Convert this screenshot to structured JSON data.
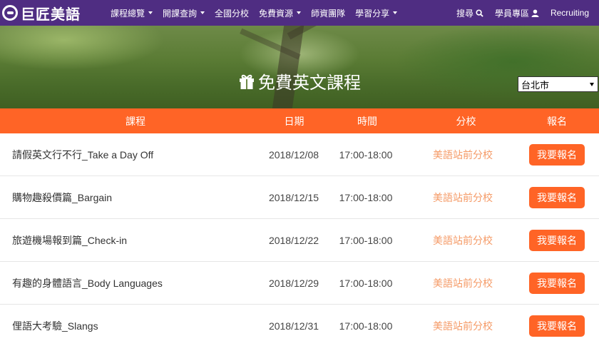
{
  "brand": {
    "logo_text": "巨匠美語"
  },
  "nav": {
    "items": [
      {
        "label": "課程總覽",
        "dropdown": true
      },
      {
        "label": "開課查詢",
        "dropdown": true
      },
      {
        "label": "全國分校",
        "dropdown": false
      },
      {
        "label": "免費資源",
        "dropdown": true
      },
      {
        "label": "師資團隊",
        "dropdown": false
      },
      {
        "label": "學習分享",
        "dropdown": true
      }
    ],
    "search_label": "搜尋",
    "member_label": "學員專區",
    "recruiting_label": "Recruiting"
  },
  "hero": {
    "title": "免費英文課程",
    "icon": "gift-icon"
  },
  "city_select": {
    "selected": "台北市"
  },
  "table": {
    "headers": [
      "課程",
      "日期",
      "時間",
      "分校",
      "報名"
    ],
    "rows": [
      {
        "course": "請假英文行不行_Take a Day Off",
        "date": "2018/12/08",
        "time": "17:00-18:00",
        "branch": "美語站前分校",
        "action": "我要報名"
      },
      {
        "course": "購物趣殺價篇_Bargain",
        "date": "2018/12/15",
        "time": "17:00-18:00",
        "branch": "美語站前分校",
        "action": "我要報名"
      },
      {
        "course": "旅遊機場報到篇_Check-in",
        "date": "2018/12/22",
        "time": "17:00-18:00",
        "branch": "美語站前分校",
        "action": "我要報名"
      },
      {
        "course": "有趣的身體語言_Body Languages",
        "date": "2018/12/29",
        "time": "17:00-18:00",
        "branch": "美語站前分校",
        "action": "我要報名"
      },
      {
        "course": "俚語大考驗_Slangs",
        "date": "2018/12/31",
        "time": "17:00-18:00",
        "branch": "美語站前分校",
        "action": "我要報名"
      }
    ]
  },
  "colors": {
    "nav_bg": "#4f2d82",
    "accent": "#ff6426",
    "branch_text": "#f59a66"
  }
}
